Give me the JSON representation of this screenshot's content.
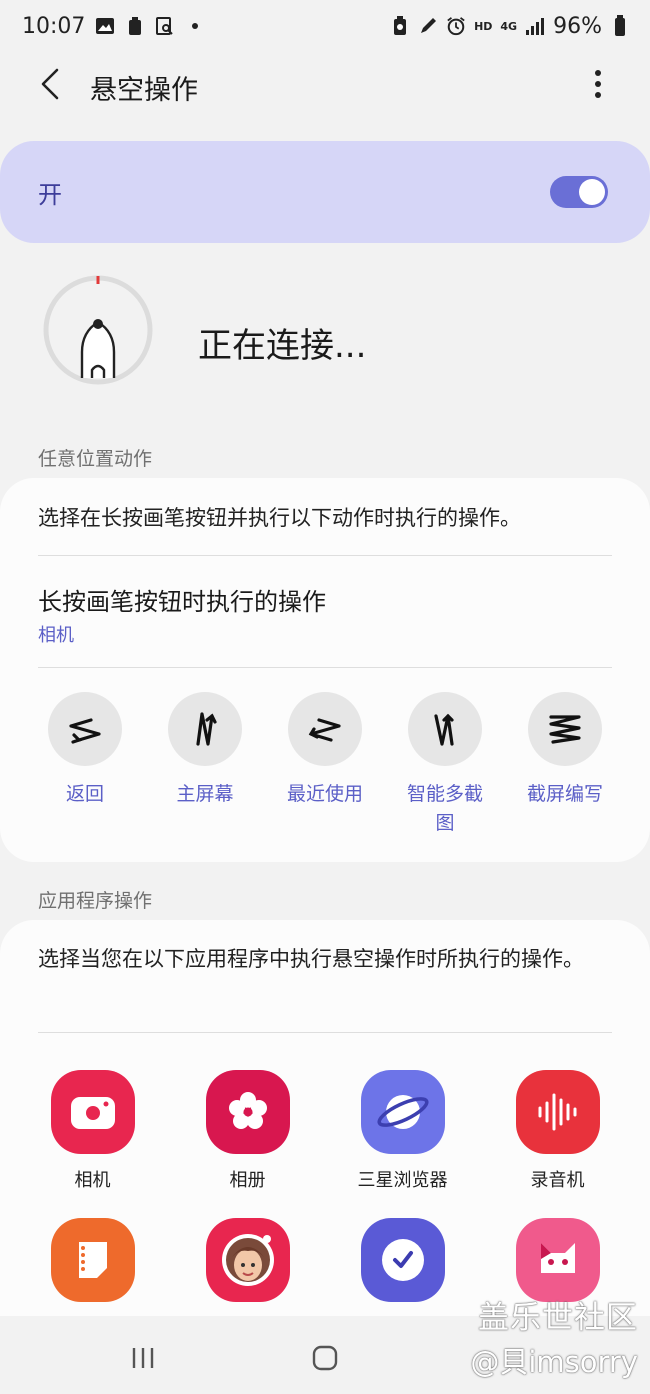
{
  "status_bar": {
    "time": "10:07",
    "net_type": "HD",
    "signal_label": "4G",
    "battery": "96%"
  },
  "app_bar": {
    "title": "悬空操作"
  },
  "master_switch": {
    "label": "开",
    "state": "on"
  },
  "pen": {
    "status_text": "正在连接..."
  },
  "anywhere_section": {
    "header": "任意位置动作",
    "description": "选择在长按画笔按钮并执行以下动作时执行的操作。",
    "long_press_title": "长按画笔按钮时执行的操作",
    "long_press_value": "相机",
    "gestures": [
      {
        "label": "返回",
        "icon": "swipe-left-right-icon"
      },
      {
        "label": "主屏幕",
        "icon": "swipe-up-down-icon"
      },
      {
        "label": "最近使用",
        "icon": "swipe-right-left-icon"
      },
      {
        "label": "智能多截图",
        "icon": "swipe-down-up-icon"
      },
      {
        "label": "截屏编写",
        "icon": "zigzag-icon"
      }
    ]
  },
  "app_section": {
    "header": "应用程序操作",
    "description": "选择当您在以下应用程序中执行悬空操作时所执行的操作。",
    "apps": [
      {
        "label": "相机",
        "icon": "camera-app-icon",
        "color": "#e8264f"
      },
      {
        "label": "相册",
        "icon": "gallery-app-icon",
        "color": "#d8174f"
      },
      {
        "label": "三星浏览器",
        "icon": "browser-app-icon",
        "color": "#6d74e8"
      },
      {
        "label": "录音机",
        "icon": "voice-recorder-app-icon",
        "color": "#e8323c"
      },
      {
        "label": "",
        "icon": "notes-app-icon",
        "color": "#ee6a2c"
      },
      {
        "label": "",
        "icon": "ar-emoji-app-icon",
        "color": "#e8264f"
      },
      {
        "label": "",
        "icon": "clock-app-icon",
        "color": "#5a5ad6"
      },
      {
        "label": "",
        "icon": "pet-app-icon",
        "color": "#f05a8c"
      }
    ]
  },
  "watermark": {
    "line1": "盖乐世社区",
    "line2": "@貝imsorry"
  }
}
